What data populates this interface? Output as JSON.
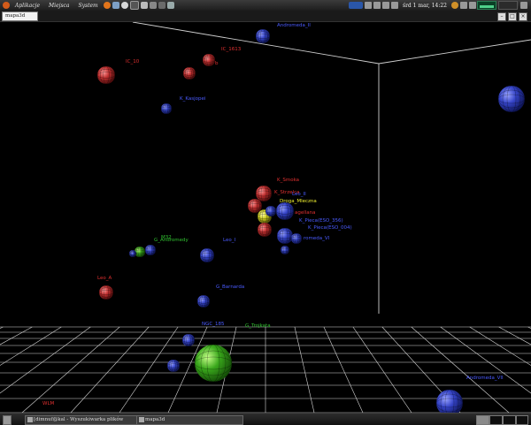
{
  "panel": {
    "menus": [
      "Aplikacje",
      "Miejsca",
      "System"
    ],
    "clock": "śrd  1 mar, 14:22"
  },
  "window": {
    "title": "mapa3d"
  },
  "scene_labels": [
    {
      "text": "Andromeda_II",
      "color": "#4a5bff"
    },
    {
      "text": "IC_1613",
      "color": "#e03030"
    },
    {
      "text": "IC_10",
      "color": "#e03030"
    },
    {
      "text": "b",
      "color": "#e03030"
    },
    {
      "text": "K_Kasjopei",
      "color": "#4a5bff"
    },
    {
      "text": "K_Smoka",
      "color": "#e03030"
    },
    {
      "text": "K_Strzelca",
      "color": "#e03030"
    },
    {
      "text": "Leo_II",
      "color": "#4a5bff"
    },
    {
      "text": "Droga_Mleczna",
      "color": "#f0f030"
    },
    {
      "text": "agellana",
      "color": "#e03030"
    },
    {
      "text": "K_Pieca(ESO_356)",
      "color": "#4a5bff"
    },
    {
      "text": "K_Pieca(ESO_004)",
      "color": "#4a5bff"
    },
    {
      "text": "romeda_VI",
      "color": "#4a5bff"
    },
    {
      "text": "M32",
      "color": "#30c030"
    },
    {
      "text": "G_Andromedy",
      "color": "#30c030"
    },
    {
      "text": "Leo_I",
      "color": "#4a5bff"
    },
    {
      "text": "Leo_A",
      "color": "#e03030"
    },
    {
      "text": "G_Barnarda",
      "color": "#4a5bff"
    },
    {
      "text": "NGC_185",
      "color": "#4a5bff"
    },
    {
      "text": "G_Trojkata",
      "color": "#30c030"
    },
    {
      "text": "Andromeda_VII",
      "color": "#4a5bff"
    },
    {
      "text": "WLM",
      "color": "#e03030"
    }
  ],
  "taskbar": {
    "tasks": [
      "[dimnuf@kal - Wyszukiwarka plików",
      "mapa3d"
    ]
  }
}
